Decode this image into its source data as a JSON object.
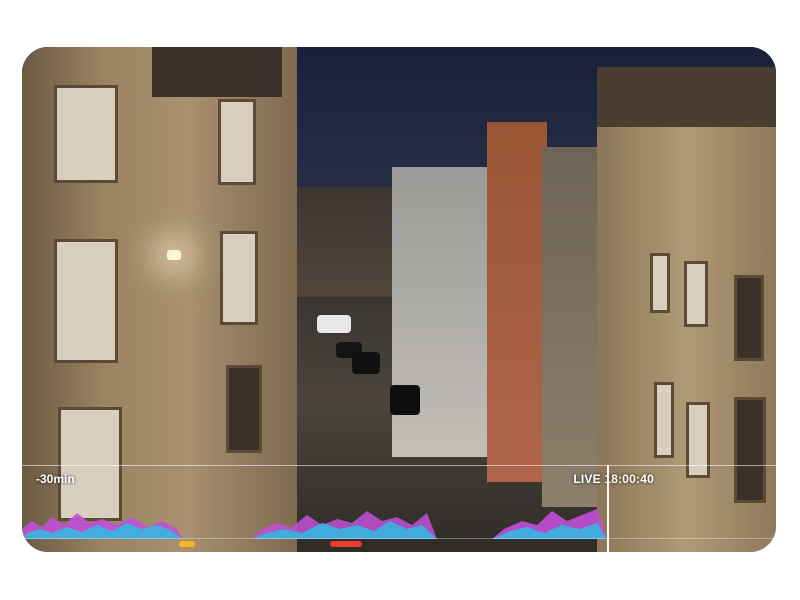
{
  "timeline": {
    "range_label": "-30min",
    "live_label": "LIVE 18:00:40"
  },
  "colors": {
    "event_marker_yellow": "#f5b820",
    "event_marker_red": "#ee3b2b",
    "activity_pink": "#c24fd8",
    "activity_cyan": "#36b6e0",
    "playhead": "#ffffff"
  },
  "icons": []
}
